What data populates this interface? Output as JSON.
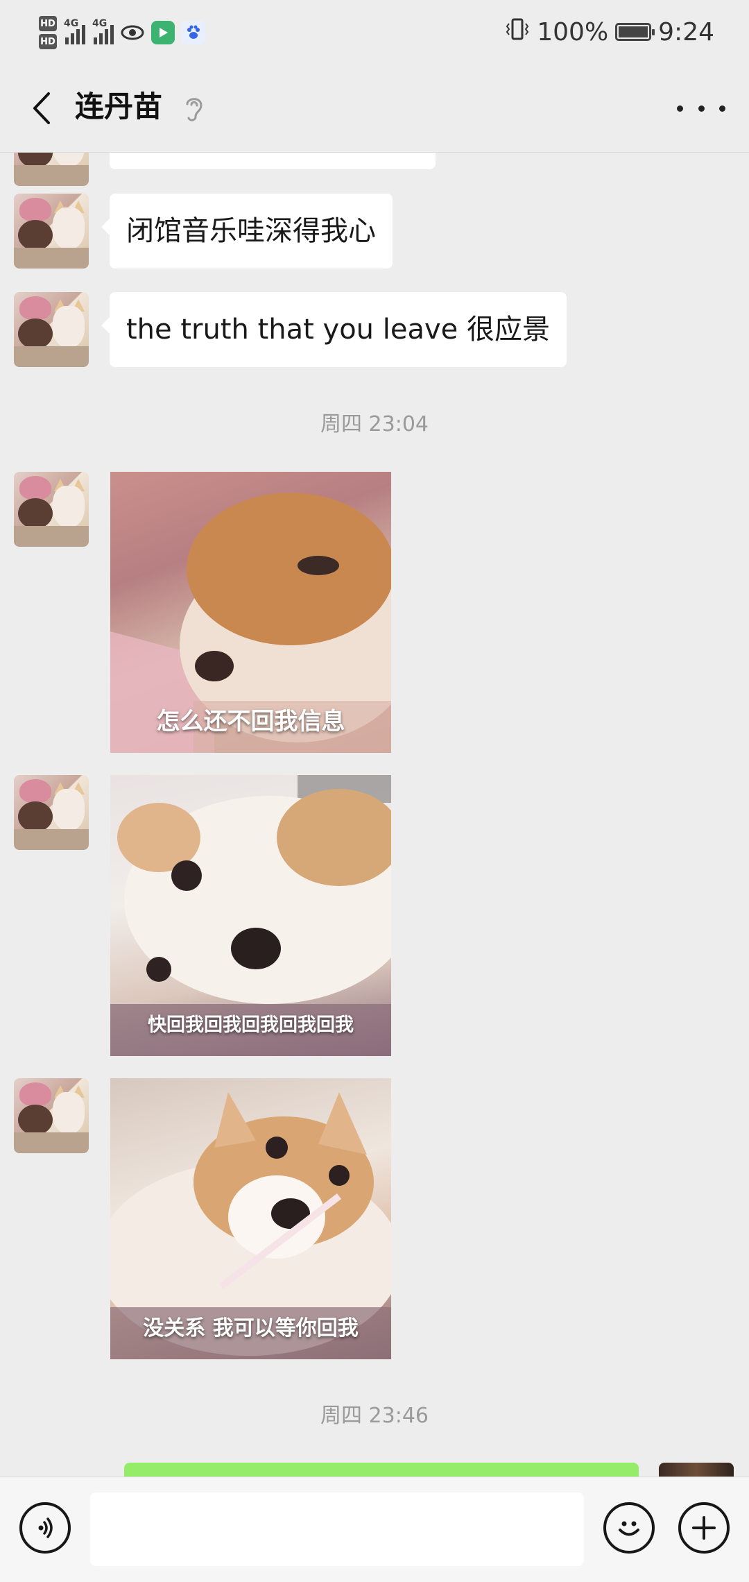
{
  "status_bar": {
    "hd1": "HD",
    "hd2": "HD",
    "net1": "4G",
    "net2": "4G",
    "battery_percent": "100%",
    "battery_level": 1.0,
    "time": "9:24"
  },
  "header": {
    "title": "连丹苗"
  },
  "messages": [
    {
      "text": "闭馆音乐哇深得我心"
    },
    {
      "text": "the truth that you leave 很应景"
    }
  ],
  "timestamps": [
    "周四 23:04",
    "周四 23:46"
  ],
  "stickers": [
    {
      "caption": "怎么还不回我信息"
    },
    {
      "caption": "快回我回我回我回我回我"
    },
    {
      "caption": "没关系 我可以等你回我"
    }
  ],
  "colors": {
    "background": "#ededed",
    "bubble_received": "#ffffff",
    "bubble_sent": "#95ec69",
    "timestamp": "#9a9a9a"
  },
  "icons": {
    "back": "chevron-left-icon",
    "earpiece": "ear-icon",
    "more": "more-dots-icon",
    "voice": "voice-icon",
    "emoji": "emoji-icon",
    "add": "plus-icon"
  }
}
